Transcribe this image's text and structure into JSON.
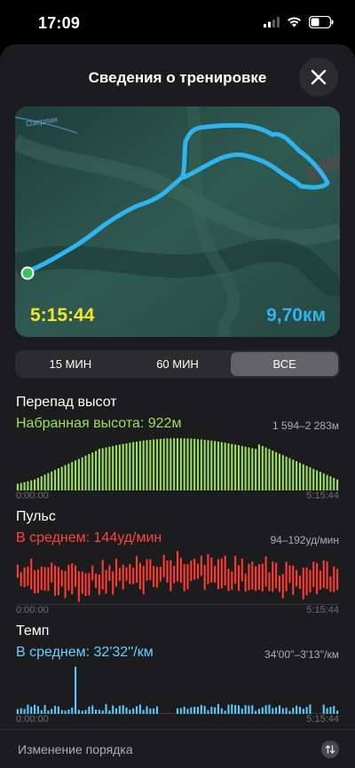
{
  "status_bar": {
    "time": "17:09",
    "icons": [
      "signal-icon",
      "wifi-icon",
      "battery-icon"
    ]
  },
  "header": {
    "title": "Сведения о тренировке",
    "close_icon": "close-icon"
  },
  "map": {
    "place_label": "Озерлия",
    "duration": "5:15:44",
    "distance": "9,70км",
    "colors": {
      "route": "#2fb4f0",
      "duration": "#f2e62d",
      "start_marker": "#34c759"
    }
  },
  "segmented": {
    "options": [
      "15 МИН",
      "60 МИН",
      "ВСЕ"
    ],
    "selected": "ВСЕ"
  },
  "elevation": {
    "title": "Перепад высот",
    "summary": "Набранная высота: 922м",
    "range": "1 594–2 283м",
    "axis_start": "0:00:00",
    "axis_end": "5:15:44",
    "color": "#9be15d"
  },
  "heart_rate": {
    "title": "Пульс",
    "summary": "В среднем: 144уд/мин",
    "range": "94–192уд/мин",
    "axis_start": "0:00:00",
    "axis_end": "5:15:44",
    "color": "#ff3b30"
  },
  "pace": {
    "title": "Темп",
    "summary": "В среднем: 32'32''/км",
    "range": "34'00''–3'13''/км",
    "axis_start": "0:00:00",
    "axis_end": "5:15:44",
    "color": "#5ac8fa"
  },
  "footer": {
    "label": "Изменение порядка",
    "icon": "reorder-icon"
  }
}
